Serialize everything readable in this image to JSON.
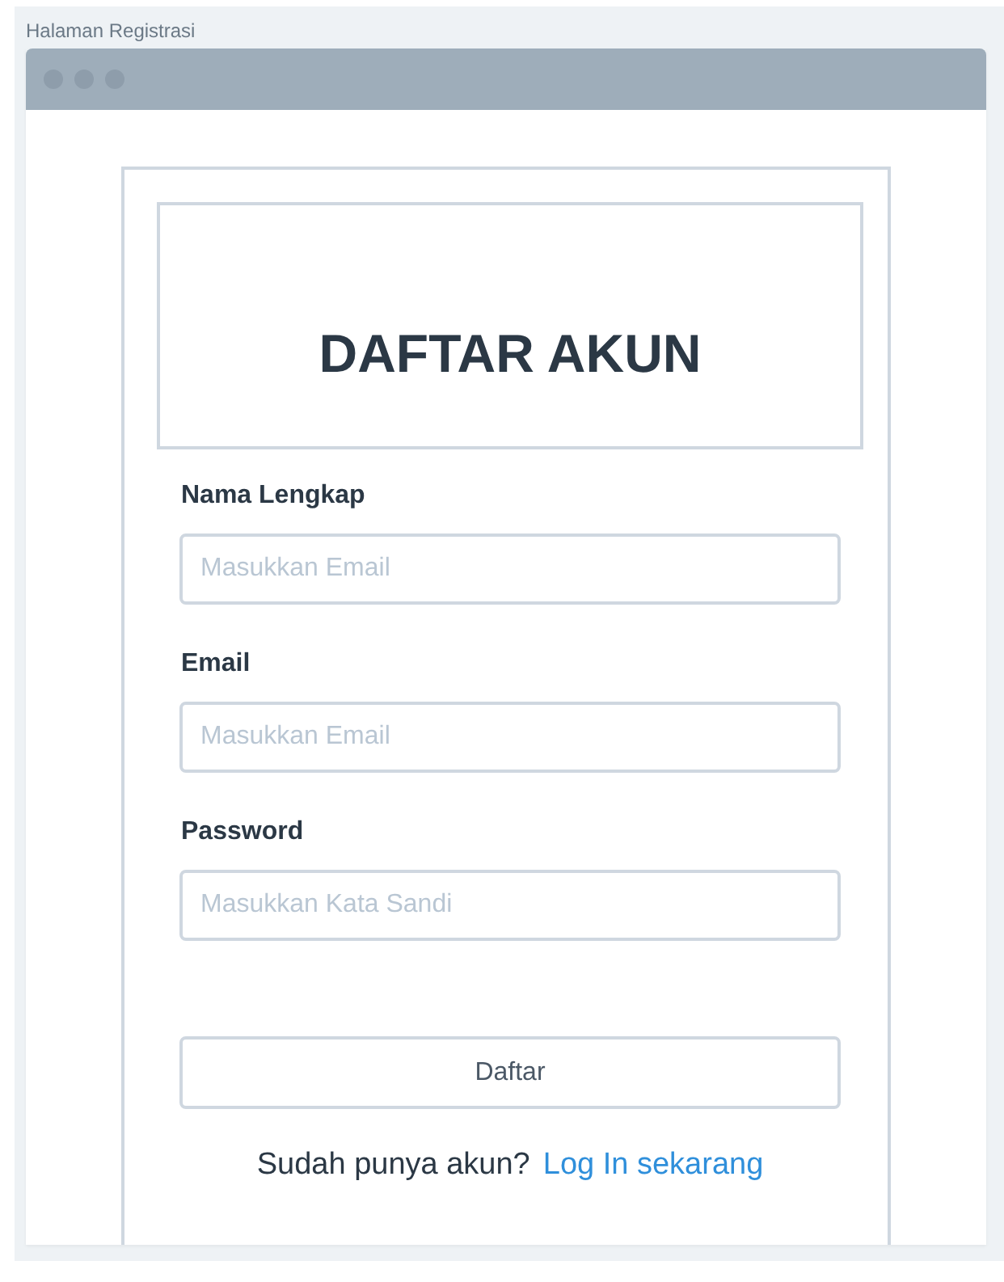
{
  "frame": {
    "title": "Halaman Registrasi"
  },
  "form": {
    "heading": "DAFTAR AKUN",
    "fields": [
      {
        "label": "Nama Lengkap",
        "placeholder": "Masukkan Email"
      },
      {
        "label": "Email",
        "placeholder": "Masukkan Email"
      },
      {
        "label": "Password",
        "placeholder": "Masukkan Kata Sandi"
      }
    ],
    "submit_button": "Daftar",
    "footer": {
      "text": "Sudah punya akun?",
      "link": "Log In sekarang"
    }
  }
}
